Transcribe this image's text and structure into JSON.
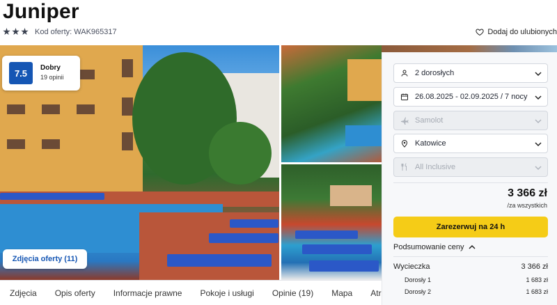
{
  "header": {
    "title": "Juniper",
    "stars": 3,
    "offer_code": "Kod oferty: WAK965317",
    "favorite_label": "Dodaj do ulubionych"
  },
  "gallery": {
    "rating_score": "7.5",
    "rating_label": "Dobry",
    "rating_count": "19 opinii",
    "photos_button": "Zdjęcia oferty (11)"
  },
  "tabs": [
    "Zdjęcia",
    "Opis oferty",
    "Informacje prawne",
    "Pokoje i usługi",
    "Opinie (19)",
    "Mapa",
    "Atrakcje"
  ],
  "booking": {
    "guests": "2 dorosłych",
    "dates": "26.08.2025 - 02.09.2025 / 7 nocy",
    "transport": "Samolot",
    "departure": "Katowice",
    "board": "All Inclusive",
    "price": "3 366 zł",
    "price_note": "/za wszystkich",
    "book_button": "Zarezerwuj na 24 h",
    "summary_toggle": "Podsumowanie ceny",
    "summary": {
      "trip_label": "Wycieczka",
      "trip_value": "3 366 zł",
      "lines": [
        {
          "label": "Dorosły 1",
          "value": "1 683 zł"
        },
        {
          "label": "Dorosły 2",
          "value": "1 683 zł"
        }
      ]
    }
  },
  "colors": {
    "accent_blue": "#1556b4",
    "book_yellow": "#f5cc17"
  }
}
